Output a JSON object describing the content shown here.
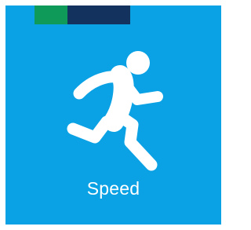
{
  "tile": {
    "label": "Speed",
    "icon": "running-person-icon"
  },
  "colors": {
    "tile_bg": "#0aa2e5",
    "stripe": [
      "#0aa2e5",
      "#0f9a5a",
      "#13335e",
      "#0aa2e5"
    ],
    "icon": "#ffffff",
    "label": "#ffffff"
  }
}
